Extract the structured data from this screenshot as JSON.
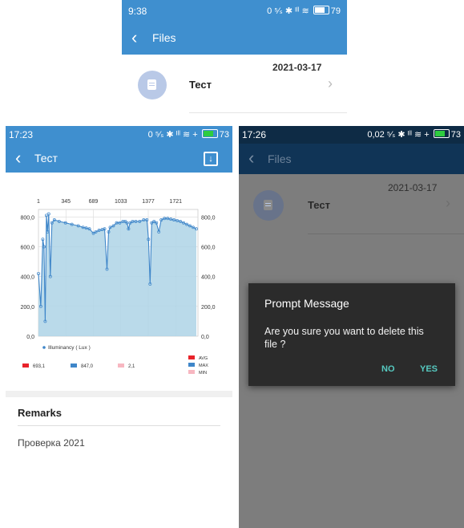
{
  "top": {
    "status": {
      "time": "9:38",
      "right": "0 ⁵⁄ₛ ✱ ᴵˡˡ ≋",
      "battery": "79"
    },
    "back_icon": "back-arrow-icon",
    "title": "Files",
    "file": {
      "date": "2021-03-17",
      "name": "Тест"
    }
  },
  "chart_screen": {
    "status": {
      "time": "17:23",
      "right": "0 ⁵⁄ₛ ✱ ᴵˡˡ ≋ +",
      "battery": "73"
    },
    "title": "Тест",
    "download_icon": "download-icon",
    "chart_data": {
      "type": "area",
      "x_ticks": [
        "1",
        "345",
        "689",
        "1033",
        "1377",
        "1721"
      ],
      "y_ticks": [
        "0,0",
        "200,0",
        "400,0",
        "600,0",
        "800,0"
      ],
      "ylim": [
        0,
        850
      ],
      "xlim": [
        1,
        2000
      ],
      "series": [
        {
          "name": "Illuminancy ( Lux )",
          "x": [
            1,
            30,
            55,
            70,
            85,
            100,
            115,
            130,
            150,
            170,
            200,
            260,
            340,
            420,
            500,
            560,
            600,
            640,
            690,
            720,
            760,
            800,
            830,
            860,
            880,
            900,
            940,
            980,
            1020,
            1060,
            1090,
            1110,
            1130,
            1150,
            1180,
            1220,
            1270,
            1320,
            1360,
            1380,
            1400,
            1420,
            1450,
            1480,
            1510,
            1540,
            1580,
            1620,
            1660,
            1700,
            1740,
            1780,
            1820,
            1860,
            1900,
            1940,
            1980
          ],
          "values": [
            420,
            200,
            650,
            600,
            100,
            810,
            700,
            820,
            400,
            760,
            780,
            770,
            760,
            750,
            740,
            730,
            725,
            720,
            690,
            700,
            710,
            715,
            720,
            450,
            700,
            730,
            740,
            760,
            760,
            770,
            770,
            760,
            720,
            760,
            770,
            770,
            770,
            780,
            780,
            650,
            350,
            760,
            770,
            760,
            700,
            780,
            790,
            790,
            785,
            780,
            775,
            770,
            760,
            750,
            740,
            730,
            720
          ]
        }
      ],
      "stats": [
        {
          "label": "AVG",
          "value": "693,1",
          "color": "#e8232a"
        },
        {
          "label": "MAX",
          "value": "847,0",
          "color": "#3f86c9"
        },
        {
          "label": "MIN",
          "value": "2,1",
          "color": "#f7b7c1"
        }
      ]
    },
    "remarks_title": "Remarks",
    "remarks_text": "Проверка 2021"
  },
  "delete_screen": {
    "status": {
      "time": "17:26",
      "right": "0,02 ⁵⁄ₛ ✱ ᴵˡˡ ≋ +",
      "battery": "73"
    },
    "title": "Files",
    "file": {
      "date": "2021-03-17",
      "name": "Тест"
    },
    "dialog": {
      "title": "Prompt Message",
      "body": "Are you sure you want to delete this file ?",
      "no_label": "NO",
      "yes_label": "YES"
    }
  },
  "colors": {
    "primary": "#3f8fcf",
    "dark_primary": "#103456",
    "chart_fill": "#aed3e6",
    "accent": "#56c9c0"
  }
}
